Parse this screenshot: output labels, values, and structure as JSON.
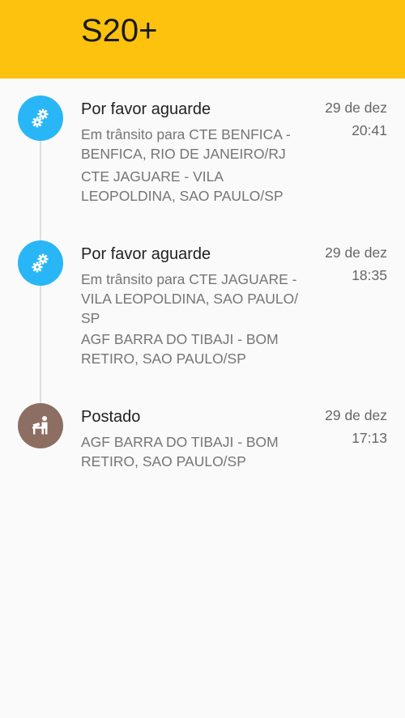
{
  "header": {
    "title": "S20+",
    "color": "#fdc20d"
  },
  "events": [
    {
      "icon": "gears-icon",
      "icon_color": "#29b6f6",
      "title": "Por favor aguarde",
      "line1": "Em trânsito para CTE BENFICA -",
      "line2": "BENFICA, RIO DE JANEIRO/RJ",
      "line3": "CTE JAGUARE - VILA",
      "line4": "LEOPOLDINA, SAO PAULO/SP",
      "date": "29 de dez",
      "time": "20:41"
    },
    {
      "icon": "gears-icon",
      "icon_color": "#29b6f6",
      "title": "Por favor aguarde",
      "line1": "Em trânsito para CTE JAGUARE -",
      "line2": "VILA LEOPOLDINA, SAO PAULO/",
      "line3": "SP",
      "line4": "AGF BARRA DO TIBAJI - BOM",
      "line5": "RETIRO, SAO PAULO/SP",
      "date": "29 de dez",
      "time": "18:35"
    },
    {
      "icon": "posting-counter-icon",
      "icon_color": "#8d6e63",
      "title": "Postado",
      "line1": "AGF BARRA DO TIBAJI - BOM",
      "line2": "RETIRO, SAO PAULO/SP",
      "date": "29 de dez",
      "time": "17:13"
    }
  ]
}
